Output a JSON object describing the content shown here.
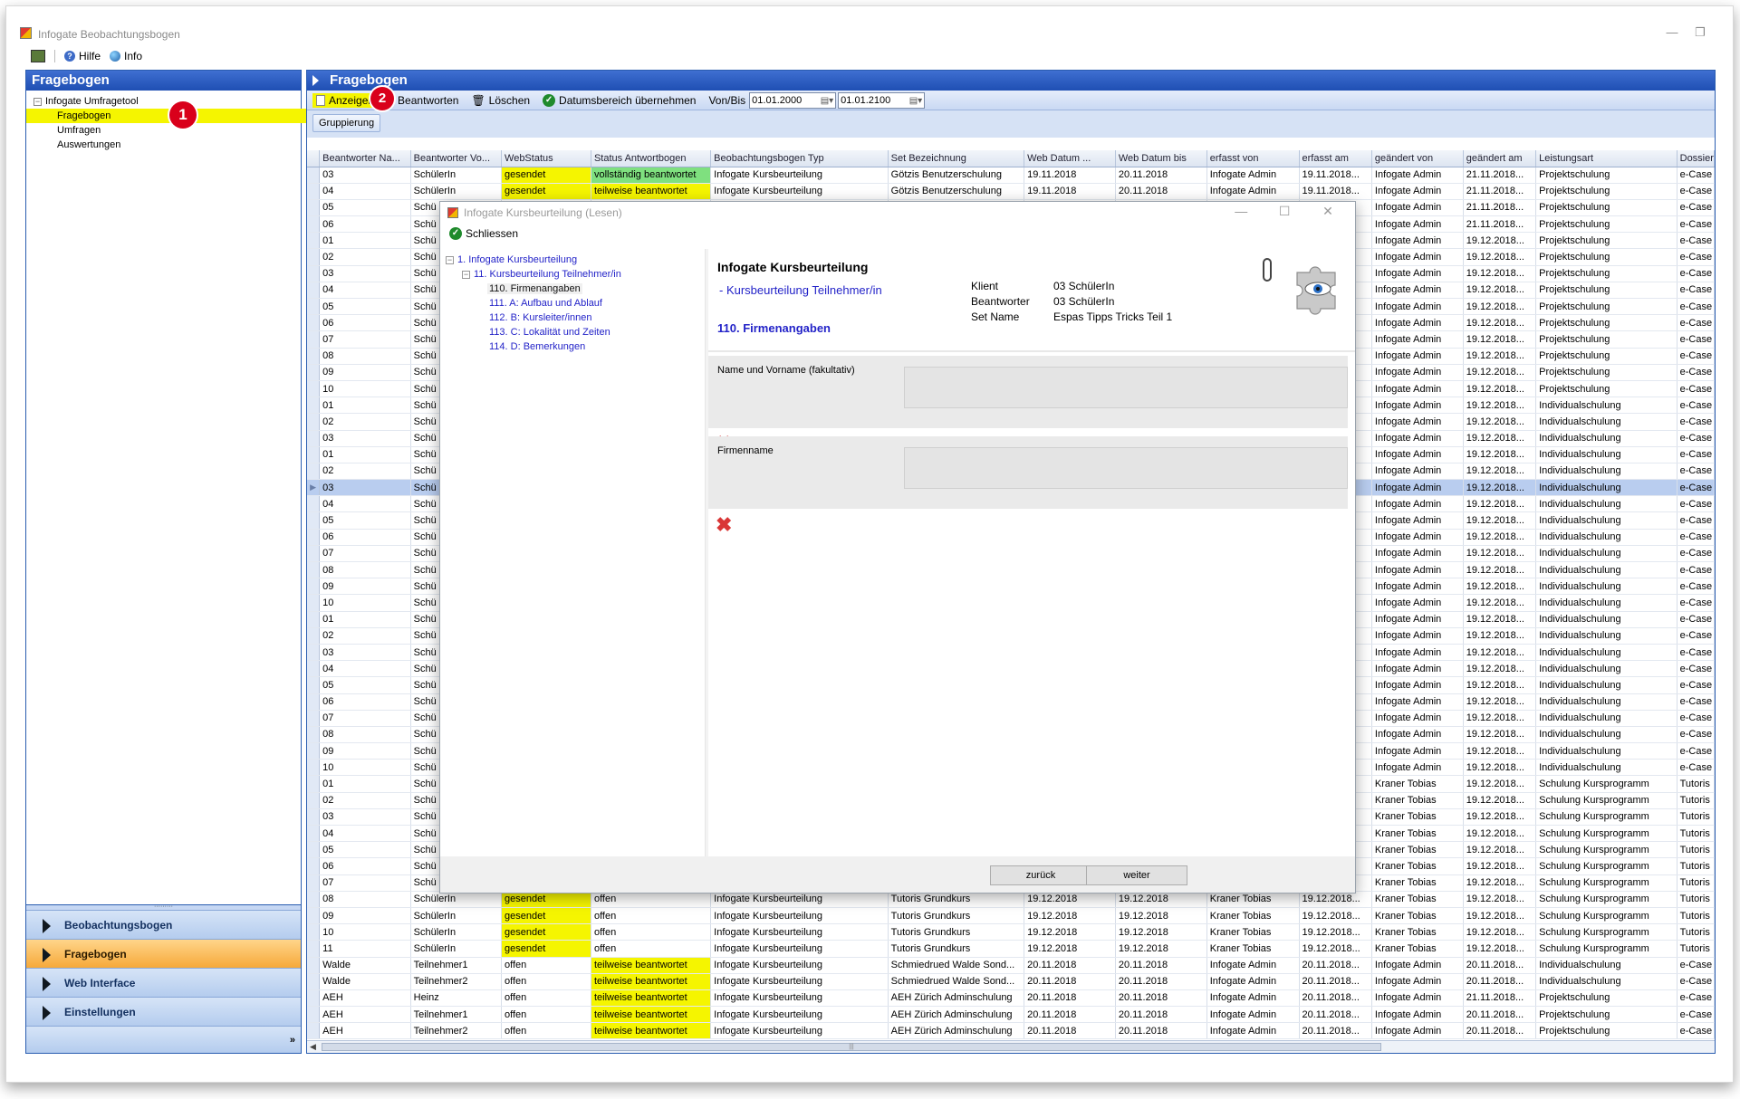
{
  "app": {
    "title": "Infogate Beobachtungsbogen",
    "menu": {
      "hilfe": "Hilfe",
      "info": "Info"
    },
    "win_min": "—",
    "win_restore": "❐"
  },
  "left": {
    "header": "Fragebogen",
    "tree": {
      "root": "Infogate Umfragetool",
      "items": [
        "Fragebogen",
        "Umfragen",
        "Auswertungen"
      ]
    },
    "badge1": "1",
    "nav": [
      "Beobachtungsbogen",
      "Fragebogen",
      "Web Interface",
      "Einstellungen"
    ],
    "nav_grip": "·········",
    "nav_more": "»"
  },
  "right": {
    "header": "Fragebogen",
    "toolbar": {
      "anzeigen": "Anzeigen",
      "badge2": "2",
      "beantworten": "Beantworten",
      "loeschen": "Löschen",
      "datumsbereich": "Datumsbereich übernehmen",
      "vonbis": "Von/Bis",
      "date_from": "01.01.2000",
      "date_to": "01.01.2100"
    },
    "grouping": "Gruppierung"
  },
  "grid": {
    "columns": [
      "Beantworter Na...",
      "Beantworter Vo...",
      "WebStatus",
      "Status Antwortbogen",
      "Beobachtungsbogen Typ",
      "Set Bezeichnung",
      "Web Datum ...",
      "Web Datum bis",
      "erfasst von",
      "erfasst am",
      "geändert von",
      "geändert am",
      "Leistungsart",
      "Dossier"
    ],
    "rows": [
      [
        "03",
        "SchülerIn",
        "gesendet",
        "vollständig beantwortet",
        "Infogate Kursbeurteilung",
        "Götzis Benutzerschulung",
        "19.11.2018",
        "20.11.2018",
        "Infogate Admin",
        "19.11.2018...",
        "Infogate Admin",
        "21.11.2018...",
        "Projektschulung",
        "e-Case"
      ],
      [
        "04",
        "SchülerIn",
        "gesendet",
        "teilweise beantwortet",
        "Infogate Kursbeurteilung",
        "Götzis Benutzerschulung",
        "19.11.2018",
        "20.11.2018",
        "Infogate Admin",
        "19.11.2018...",
        "Infogate Admin",
        "21.11.2018...",
        "Projektschulung",
        "e-Case"
      ],
      [
        "05",
        "Schü",
        "",
        "",
        "",
        "",
        "",
        "",
        "",
        "...",
        "Infogate Admin",
        "21.11.2018...",
        "Projektschulung",
        "e-Case"
      ],
      [
        "06",
        "Schü",
        "",
        "",
        "",
        "",
        "",
        "",
        "",
        "...",
        "Infogate Admin",
        "21.11.2018...",
        "Projektschulung",
        "e-Case"
      ],
      [
        "01",
        "Schü",
        "",
        "",
        "",
        "",
        "",
        "",
        "",
        "...",
        "Infogate Admin",
        "19.12.2018...",
        "Projektschulung",
        "e-Case"
      ],
      [
        "02",
        "Schü",
        "",
        "",
        "",
        "",
        "",
        "",
        "",
        "...",
        "Infogate Admin",
        "19.12.2018...",
        "Projektschulung",
        "e-Case"
      ],
      [
        "03",
        "Schü",
        "",
        "",
        "",
        "",
        "",
        "",
        "",
        "...",
        "Infogate Admin",
        "19.12.2018...",
        "Projektschulung",
        "e-Case"
      ],
      [
        "04",
        "Schü",
        "",
        "",
        "",
        "",
        "",
        "",
        "",
        "...",
        "Infogate Admin",
        "19.12.2018...",
        "Projektschulung",
        "e-Case"
      ],
      [
        "05",
        "Schü",
        "",
        "",
        "",
        "",
        "",
        "",
        "",
        "...",
        "Infogate Admin",
        "19.12.2018...",
        "Projektschulung",
        "e-Case"
      ],
      [
        "06",
        "Schü",
        "",
        "",
        "",
        "",
        "",
        "",
        "",
        "...",
        "Infogate Admin",
        "19.12.2018...",
        "Projektschulung",
        "e-Case"
      ],
      [
        "07",
        "Schü",
        "",
        "",
        "",
        "",
        "",
        "",
        "",
        "...",
        "Infogate Admin",
        "19.12.2018...",
        "Projektschulung",
        "e-Case"
      ],
      [
        "08",
        "Schü",
        "",
        "",
        "",
        "",
        "",
        "",
        "",
        "...",
        "Infogate Admin",
        "19.12.2018...",
        "Projektschulung",
        "e-Case"
      ],
      [
        "09",
        "Schü",
        "",
        "",
        "",
        "",
        "",
        "",
        "",
        "...",
        "Infogate Admin",
        "19.12.2018...",
        "Projektschulung",
        "e-Case"
      ],
      [
        "10",
        "Schü",
        "",
        "",
        "",
        "",
        "",
        "",
        "",
        "...",
        "Infogate Admin",
        "19.12.2018...",
        "Projektschulung",
        "e-Case"
      ],
      [
        "01",
        "Schü",
        "",
        "",
        "",
        "",
        "",
        "",
        "",
        "...",
        "Infogate Admin",
        "19.12.2018...",
        "Individualschulung",
        "e-Case"
      ],
      [
        "02",
        "Schü",
        "",
        "",
        "",
        "",
        "",
        "",
        "",
        "...",
        "Infogate Admin",
        "19.12.2018...",
        "Individualschulung",
        "e-Case"
      ],
      [
        "03",
        "Schü",
        "",
        "",
        "",
        "",
        "",
        "",
        "",
        "...",
        "Infogate Admin",
        "19.12.2018...",
        "Individualschulung",
        "e-Case"
      ],
      [
        "01",
        "Schü",
        "",
        "",
        "",
        "",
        "",
        "",
        "",
        "...",
        "Infogate Admin",
        "19.12.2018...",
        "Individualschulung",
        "e-Case"
      ],
      [
        "02",
        "Schü",
        "",
        "",
        "",
        "",
        "",
        "",
        "",
        "...",
        "Infogate Admin",
        "19.12.2018...",
        "Individualschulung",
        "e-Case"
      ],
      [
        "03",
        "Schü",
        "",
        "",
        "",
        "",
        "",
        "",
        "",
        "...",
        "Infogate Admin",
        "19.12.2018...",
        "Individualschulung",
        "e-Case"
      ],
      [
        "04",
        "Schü",
        "",
        "",
        "",
        "",
        "",
        "",
        "",
        "...",
        "Infogate Admin",
        "19.12.2018...",
        "Individualschulung",
        "e-Case"
      ],
      [
        "05",
        "Schü",
        "",
        "",
        "",
        "",
        "",
        "",
        "",
        "...",
        "Infogate Admin",
        "19.12.2018...",
        "Individualschulung",
        "e-Case"
      ],
      [
        "06",
        "Schü",
        "",
        "",
        "",
        "",
        "",
        "",
        "",
        "...",
        "Infogate Admin",
        "19.12.2018...",
        "Individualschulung",
        "e-Case"
      ],
      [
        "07",
        "Schü",
        "",
        "",
        "",
        "",
        "",
        "",
        "",
        "...",
        "Infogate Admin",
        "19.12.2018...",
        "Individualschulung",
        "e-Case"
      ],
      [
        "08",
        "Schü",
        "",
        "",
        "",
        "",
        "",
        "",
        "",
        "...",
        "Infogate Admin",
        "19.12.2018...",
        "Individualschulung",
        "e-Case"
      ],
      [
        "09",
        "Schü",
        "",
        "",
        "",
        "",
        "",
        "",
        "",
        "...",
        "Infogate Admin",
        "19.12.2018...",
        "Individualschulung",
        "e-Case"
      ],
      [
        "10",
        "Schü",
        "",
        "",
        "",
        "",
        "",
        "",
        "",
        "...",
        "Infogate Admin",
        "19.12.2018...",
        "Individualschulung",
        "e-Case"
      ],
      [
        "01",
        "Schü",
        "",
        "",
        "",
        "",
        "",
        "",
        "",
        "...",
        "Infogate Admin",
        "19.12.2018...",
        "Individualschulung",
        "e-Case"
      ],
      [
        "02",
        "Schü",
        "",
        "",
        "",
        "",
        "",
        "",
        "",
        "...",
        "Infogate Admin",
        "19.12.2018...",
        "Individualschulung",
        "e-Case"
      ],
      [
        "03",
        "Schü",
        "",
        "",
        "",
        "",
        "",
        "",
        "",
        "...",
        "Infogate Admin",
        "19.12.2018...",
        "Individualschulung",
        "e-Case"
      ],
      [
        "04",
        "Schü",
        "",
        "",
        "",
        "",
        "",
        "",
        "",
        "...",
        "Infogate Admin",
        "19.12.2018...",
        "Individualschulung",
        "e-Case"
      ],
      [
        "05",
        "Schü",
        "",
        "",
        "",
        "",
        "",
        "",
        "",
        "...",
        "Infogate Admin",
        "19.12.2018...",
        "Individualschulung",
        "e-Case"
      ],
      [
        "06",
        "Schü",
        "",
        "",
        "",
        "",
        "",
        "",
        "",
        "...",
        "Infogate Admin",
        "19.12.2018...",
        "Individualschulung",
        "e-Case"
      ],
      [
        "07",
        "Schü",
        "",
        "",
        "",
        "",
        "",
        "",
        "",
        "...",
        "Infogate Admin",
        "19.12.2018...",
        "Individualschulung",
        "e-Case"
      ],
      [
        "08",
        "Schü",
        "",
        "",
        "",
        "",
        "",
        "",
        "",
        "...",
        "Infogate Admin",
        "19.12.2018...",
        "Individualschulung",
        "e-Case"
      ],
      [
        "09",
        "Schü",
        "",
        "",
        "",
        "",
        "",
        "",
        "",
        "...",
        "Infogate Admin",
        "19.12.2018...",
        "Individualschulung",
        "e-Case"
      ],
      [
        "10",
        "Schü",
        "",
        "",
        "",
        "",
        "",
        "",
        "",
        "...",
        "Infogate Admin",
        "19.12.2018...",
        "Individualschulung",
        "e-Case"
      ],
      [
        "01",
        "Schü",
        "",
        "",
        "",
        "",
        "",
        "",
        "",
        "...",
        "Kraner Tobias",
        "19.12.2018...",
        "Schulung Kursprogramm",
        "Tutoris"
      ],
      [
        "02",
        "Schü",
        "",
        "",
        "",
        "",
        "",
        "",
        "",
        "...",
        "Kraner Tobias",
        "19.12.2018...",
        "Schulung Kursprogramm",
        "Tutoris"
      ],
      [
        "03",
        "Schü",
        "",
        "",
        "",
        "",
        "",
        "",
        "",
        "...",
        "Kraner Tobias",
        "19.12.2018...",
        "Schulung Kursprogramm",
        "Tutoris"
      ],
      [
        "04",
        "Schü",
        "",
        "",
        "",
        "",
        "",
        "",
        "",
        "...",
        "Kraner Tobias",
        "19.12.2018...",
        "Schulung Kursprogramm",
        "Tutoris"
      ],
      [
        "05",
        "Schü",
        "",
        "",
        "",
        "",
        "",
        "",
        "",
        "...",
        "Kraner Tobias",
        "19.12.2018...",
        "Schulung Kursprogramm",
        "Tutoris"
      ],
      [
        "06",
        "Schü",
        "",
        "",
        "",
        "",
        "",
        "",
        "",
        "...",
        "Kraner Tobias",
        "19.12.2018...",
        "Schulung Kursprogramm",
        "Tutoris"
      ],
      [
        "07",
        "Schü",
        "",
        "",
        "",
        "",
        "",
        "",
        "",
        "...",
        "Kraner Tobias",
        "19.12.2018...",
        "Schulung Kursprogramm",
        "Tutoris"
      ],
      [
        "08",
        "SchülerIn",
        "gesendet",
        "offen",
        "Infogate Kursbeurteilung",
        "Tutoris Grundkurs",
        "19.12.2018",
        "19.12.2018",
        "Kraner Tobias",
        "19.12.2018...",
        "Kraner Tobias",
        "19.12.2018...",
        "Schulung Kursprogramm",
        "Tutoris"
      ],
      [
        "09",
        "SchülerIn",
        "gesendet",
        "offen",
        "Infogate Kursbeurteilung",
        "Tutoris Grundkurs",
        "19.12.2018",
        "19.12.2018",
        "Kraner Tobias",
        "19.12.2018...",
        "Kraner Tobias",
        "19.12.2018...",
        "Schulung Kursprogramm",
        "Tutoris"
      ],
      [
        "10",
        "SchülerIn",
        "gesendet",
        "offen",
        "Infogate Kursbeurteilung",
        "Tutoris Grundkurs",
        "19.12.2018",
        "19.12.2018",
        "Kraner Tobias",
        "19.12.2018...",
        "Kraner Tobias",
        "19.12.2018...",
        "Schulung Kursprogramm",
        "Tutoris"
      ],
      [
        "11",
        "SchülerIn",
        "gesendet",
        "offen",
        "Infogate Kursbeurteilung",
        "Tutoris Grundkurs",
        "19.12.2018",
        "19.12.2018",
        "Kraner Tobias",
        "19.12.2018...",
        "Kraner Tobias",
        "19.12.2018...",
        "Schulung Kursprogramm",
        "Tutoris"
      ],
      [
        "Walde",
        "Teilnehmer1",
        "offen",
        "teilweise beantwortet",
        "Infogate Kursbeurteilung",
        "Schmiedrued Walde Sond...",
        "20.11.2018",
        "20.11.2018",
        "Infogate Admin",
        "20.11.2018...",
        "Infogate Admin",
        "20.11.2018...",
        "Individualschulung",
        "e-Case"
      ],
      [
        "Walde",
        "Teilnehmer2",
        "offen",
        "teilweise beantwortet",
        "Infogate Kursbeurteilung",
        "Schmiedrued Walde Sond...",
        "20.11.2018",
        "20.11.2018",
        "Infogate Admin",
        "20.11.2018...",
        "Infogate Admin",
        "20.11.2018...",
        "Individualschulung",
        "e-Case"
      ],
      [
        "AEH",
        "Heinz",
        "offen",
        "teilweise beantwortet",
        "Infogate Kursbeurteilung",
        "AEH Zürich Adminschulung",
        "20.11.2018",
        "20.11.2018",
        "Infogate Admin",
        "20.11.2018...",
        "Infogate Admin",
        "21.11.2018...",
        "Projektschulung",
        "e-Case"
      ],
      [
        "AEH",
        "Teilnehmer1",
        "offen",
        "teilweise beantwortet",
        "Infogate Kursbeurteilung",
        "AEH Zürich Adminschulung",
        "20.11.2018",
        "20.11.2018",
        "Infogate Admin",
        "20.11.2018...",
        "Infogate Admin",
        "20.11.2018...",
        "Projektschulung",
        "e-Case"
      ],
      [
        "AEH",
        "Teilnehmer2",
        "offen",
        "teilweise beantwortet",
        "Infogate Kursbeurteilung",
        "AEH Zürich Adminschulung",
        "20.11.2018",
        "20.11.2018",
        "Infogate Admin",
        "20.11.2018...",
        "Infogate Admin",
        "20.11.2018...",
        "Projektschulung",
        "e-Case"
      ]
    ],
    "selected_row": 19,
    "scroll_grip": "|||"
  },
  "dialog": {
    "title": "Infogate Kursbeurteilung  (Lesen)",
    "win_min": "—",
    "win_max": "☐",
    "win_close": "✕",
    "close_btn": "Schliessen",
    "tree": {
      "root": "1. Infogate Kursbeurteilung",
      "child": "11. Kursbeurteilung Teilnehmer/in",
      "items": [
        "110. Firmenangaben",
        "111. A: Aufbau und Ablauf",
        "112. B: Kursleiter/innen",
        "113. C: Lokalität und Zeiten",
        "114. D: Bemerkungen"
      ]
    },
    "heading": "Infogate Kursbeurteilung",
    "subheading": "- Kursbeurteilung Teilnehmer/in",
    "section": "110. Firmenangaben",
    "meta": {
      "klient_label": "Klient",
      "klient": "03 SchülerIn",
      "beantworter_label": "Beantworter",
      "beantworter": "03 SchülerIn",
      "setname_label": "Set Name",
      "setname": "Espas Tipps  Tricks Teil 1"
    },
    "questions": [
      "Name und Vorname (fakultativ)",
      "Firmenname"
    ],
    "xmark": "✖",
    "back": "zurück",
    "next": "weiter"
  },
  "colors": {
    "accent": "#1f4fb3",
    "highlight": "#f5f500",
    "badge": "#d9001b",
    "active_nav": "#f6a93a"
  }
}
